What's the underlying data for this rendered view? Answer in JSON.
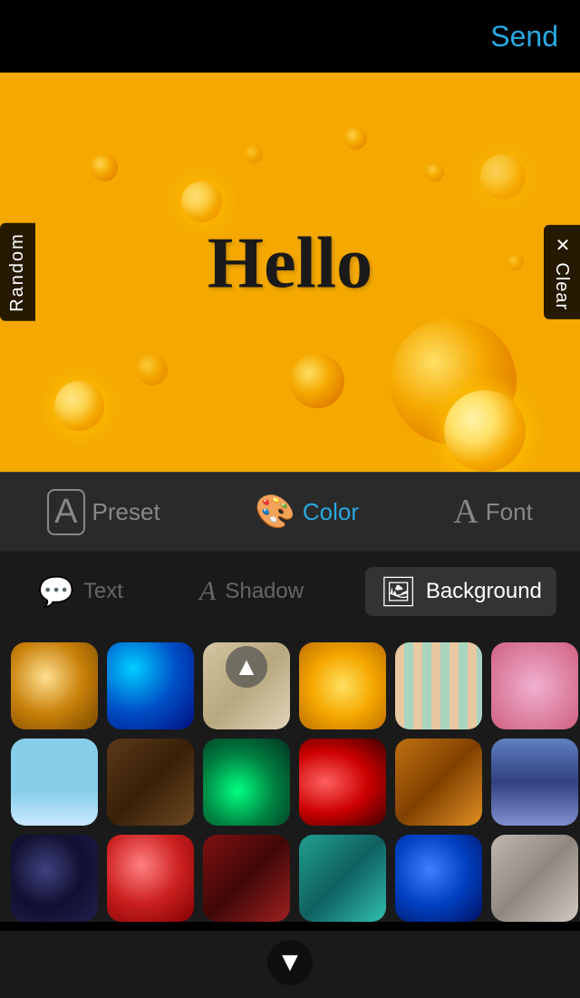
{
  "header": {
    "send_label": "Send"
  },
  "preview": {
    "hello_text": "Hello",
    "random_label": "Random",
    "clear_label": "✕ Clear"
  },
  "tabs": [
    {
      "id": "preset",
      "label": "Preset",
      "icon": "🅐",
      "active": false
    },
    {
      "id": "color",
      "label": "Color",
      "icon": "🎨",
      "active": true
    },
    {
      "id": "font",
      "label": "Font",
      "icon": "A",
      "active": false
    }
  ],
  "sub_tabs": [
    {
      "id": "text",
      "label": "Text",
      "active": false
    },
    {
      "id": "shadow",
      "label": "Shadow",
      "active": false
    },
    {
      "id": "background",
      "label": "Background",
      "active": true
    }
  ],
  "grid": {
    "rows": [
      [
        "gold-bokeh",
        "blue-sparkle",
        "beige-texture",
        "yellow-cheese",
        "stripes",
        "pink-dots"
      ],
      [
        "sky-dandelion",
        "dark-wood",
        "green-swirl",
        "red-sparkle",
        "orange-texture",
        "blue-fabric"
      ],
      [
        "dark-swirl",
        "red-orb",
        "dark-red",
        "teal-fabric",
        "blue-texture",
        "gray-stone"
      ]
    ]
  },
  "nav": {
    "up_arrow": "▲",
    "down_arrow": "▼"
  }
}
